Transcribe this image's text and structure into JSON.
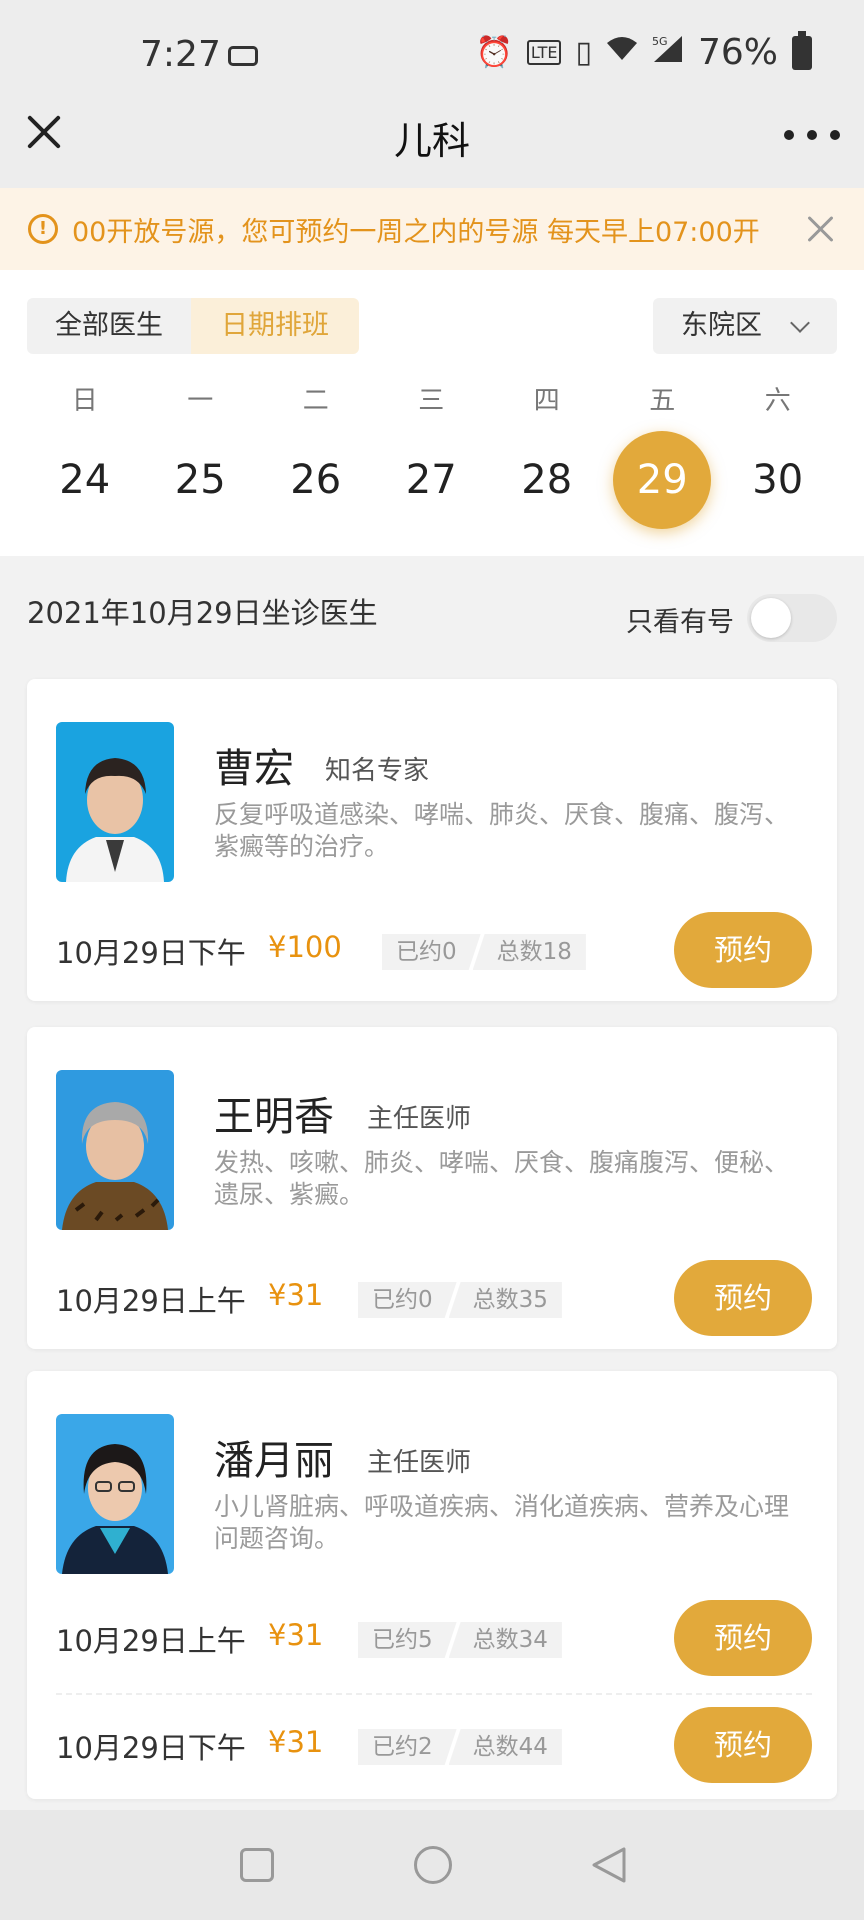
{
  "status_bar": {
    "time": "7:27",
    "battery": "76%",
    "icons": [
      "sim-card-icon",
      "alarm-icon",
      "volte-icon",
      "vibrate-icon",
      "wifi-icon",
      "5g-signal-icon",
      "battery-icon"
    ]
  },
  "nav": {
    "title": "儿科"
  },
  "notice": {
    "text": "00开放号源，您可预约一周之内的号源 每天早上07:00开"
  },
  "tabs": {
    "all_doctors": "全部医生",
    "date_schedule": "日期排班"
  },
  "district": {
    "selected": "东院区"
  },
  "calendar": {
    "weekdays": [
      "日",
      "一",
      "二",
      "三",
      "四",
      "五",
      "六"
    ],
    "days": [
      "24",
      "25",
      "26",
      "27",
      "28",
      "29",
      "30"
    ],
    "selected_day": "29",
    "accent_color": "#e2a93b"
  },
  "list_header": {
    "title": "2021年10月29日坐诊医生",
    "only_available_label": "只看有号",
    "only_available_on": false
  },
  "doctors": [
    {
      "name": "曹宏",
      "title": "知名专家",
      "desc": "反复呼吸道感染、哮喘、肺炎、厌食、腹痛、腹泻、紫癜等的治疗。",
      "slots": [
        {
          "date": "10月29日下午",
          "price": "¥100",
          "booked": "已约0",
          "total": "总数18",
          "button": "预约"
        }
      ]
    },
    {
      "name": "王明香",
      "title": "主任医师",
      "desc": "发热、咳嗽、肺炎、哮喘、厌食、腹痛腹泻、便秘、遗尿、紫癜。",
      "slots": [
        {
          "date": "10月29日上午",
          "price": "¥31",
          "booked": "已约0",
          "total": "总数35",
          "button": "预约"
        }
      ]
    },
    {
      "name": "潘月丽",
      "title": "主任医师",
      "desc": "小儿肾脏病、呼吸道疾病、消化道疾病、营养及心理问题咨询。",
      "slots": [
        {
          "date": "10月29日上午",
          "price": "¥31",
          "booked": "已约5",
          "total": "总数34",
          "button": "预约"
        },
        {
          "date": "10月29日下午",
          "price": "¥31",
          "booked": "已约2",
          "total": "总数44",
          "button": "预约"
        }
      ]
    }
  ],
  "price_color": "#e8920f"
}
